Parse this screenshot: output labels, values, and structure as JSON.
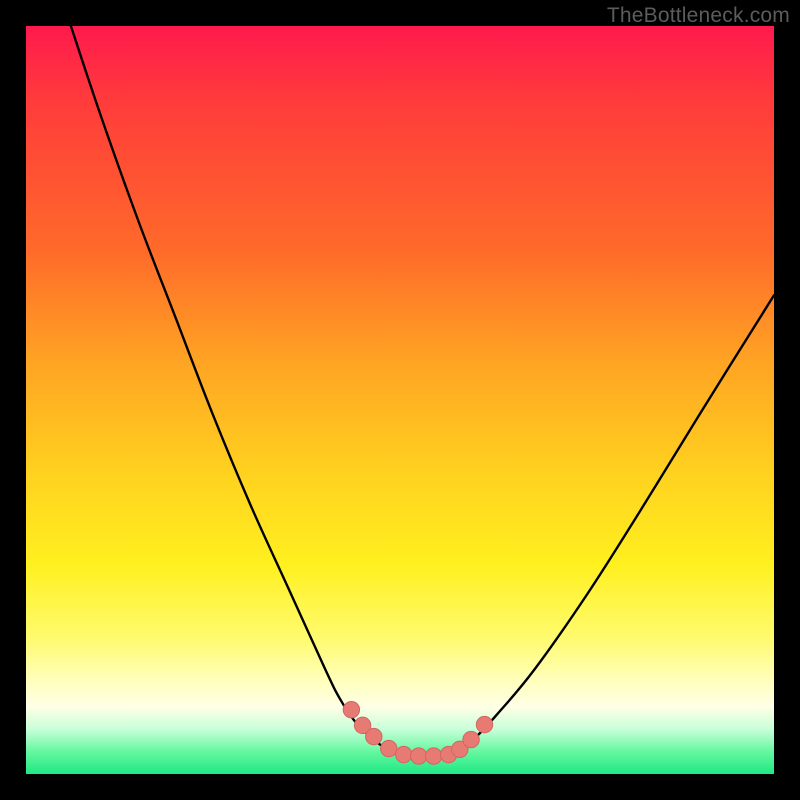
{
  "attribution": "TheBottleneck.com",
  "colors": {
    "frame": "#000000",
    "curve_stroke": "#000000",
    "marker_fill": "#e77a73",
    "marker_stroke": "#d46560",
    "gradient": [
      "#ff1a4d",
      "#ff3b3b",
      "#ff6a2a",
      "#ffa423",
      "#ffd21f",
      "#fff01f",
      "#fffb70",
      "#ffffc2",
      "#ffffe6",
      "#c7ffd9",
      "#66f7a0",
      "#1ee885"
    ]
  },
  "chart_data": {
    "type": "line",
    "title": "",
    "xlabel": "",
    "ylabel": "",
    "xlim": [
      0,
      100
    ],
    "ylim": [
      0,
      100
    ],
    "series": [
      {
        "name": "bottleneck-curve",
        "x": [
          6,
          10,
          15,
          20,
          25,
          30,
          35,
          40,
          42,
          44,
          46,
          48,
          50,
          52,
          54,
          56,
          58,
          60,
          63,
          68,
          75,
          82,
          90,
          100
        ],
        "y": [
          100,
          88,
          74,
          61,
          48,
          36,
          25,
          14,
          10,
          7,
          5,
          3.5,
          2.6,
          2.4,
          2.4,
          2.6,
          3.3,
          4.8,
          8,
          14,
          24,
          35,
          48,
          64
        ]
      }
    ],
    "markers": {
      "name": "highlight-points",
      "x": [
        43.5,
        45.0,
        46.5,
        48.5,
        50.5,
        52.5,
        54.5,
        56.5,
        58.0,
        59.5,
        61.3
      ],
      "y": [
        8.6,
        6.5,
        5.0,
        3.4,
        2.6,
        2.4,
        2.4,
        2.6,
        3.3,
        4.6,
        6.6
      ]
    }
  }
}
